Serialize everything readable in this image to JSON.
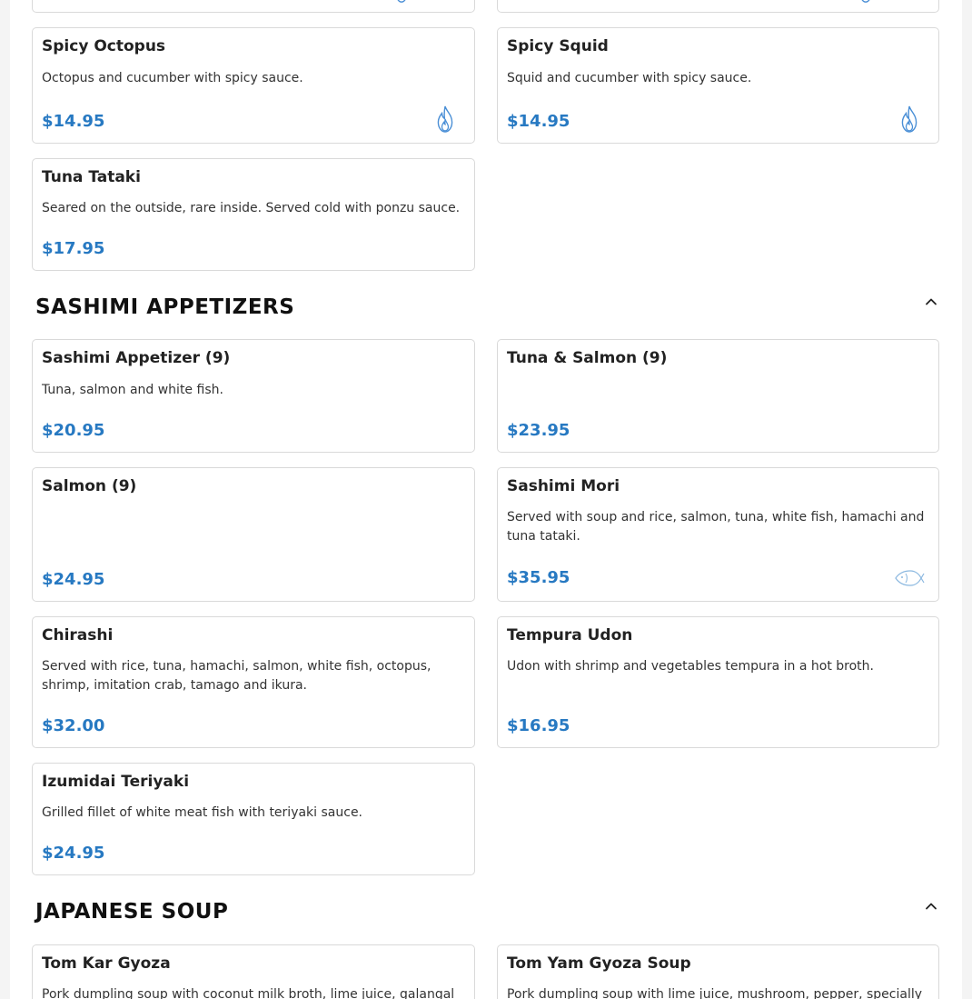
{
  "colors": {
    "price": "#2779c2",
    "icon": "#4a8fd6",
    "fish_icon": "#8bb8e0",
    "border": "#d9d9d9"
  },
  "top_partial": {
    "left_icon": "flame-icon",
    "right_icon": "flame-icon"
  },
  "top_items": [
    {
      "name": "Spicy Octopus",
      "description": "Octopus and cucumber with spicy sauce.",
      "price": "$14.95",
      "icon": "flame-icon"
    },
    {
      "name": "Spicy Squid",
      "description": "Squid and cucumber with spicy sauce.",
      "price": "$14.95",
      "icon": "flame-icon"
    },
    {
      "name": "Tuna Tataki",
      "description": "Seared on the outside, rare inside. Served cold with ponzu sauce.",
      "price": "$17.95",
      "icon": ""
    }
  ],
  "sashimi_section": {
    "title": "SASHIMI APPETIZERS",
    "items": [
      {
        "name": "Sashimi Appetizer (9)",
        "description": "Tuna, salmon and white fish.",
        "price": "$20.95",
        "icon": ""
      },
      {
        "name": "Tuna & Salmon (9)",
        "description": "",
        "price": "$23.95",
        "icon": ""
      },
      {
        "name": "Salmon (9)",
        "description": "",
        "price": "$24.95",
        "icon": ""
      },
      {
        "name": "Sashimi Mori",
        "description": "Served with soup and rice, salmon, tuna, white fish, hamachi and tuna tataki.",
        "price": "$35.95",
        "icon": "fish-icon"
      },
      {
        "name": "Chirashi",
        "description": "Served with rice, tuna, hamachi, salmon, white fish, octopus, shrimp, imitation crab, tamago and ikura.",
        "price": "$32.00",
        "icon": ""
      },
      {
        "name": "Tempura Udon",
        "description": "Udon with shrimp and vegetables tempura in a hot broth.",
        "price": "$16.95",
        "icon": ""
      },
      {
        "name": "Izumidai Teriyaki",
        "description": "Grilled fillet of white meat fish with teriyaki sauce.",
        "price": "$24.95",
        "icon": ""
      }
    ]
  },
  "soup_section": {
    "title": "JAPANESE SOUP",
    "items": [
      {
        "name": "Tom Kar Gyoza",
        "description": "Pork dumpling soup with coconut milk broth, lime juice, galangal"
      },
      {
        "name": "Tom Yam Gyoza Soup",
        "description": "Pork dumpling soup with lime juice, mushroom, pepper, specially"
      }
    ]
  }
}
